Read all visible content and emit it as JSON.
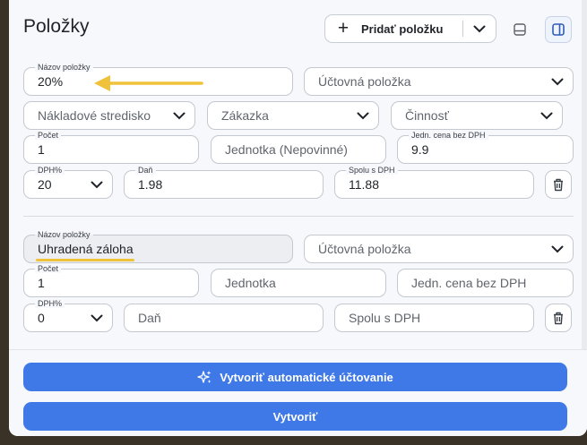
{
  "header": {
    "title": "Položky",
    "add_label": "Pridať položku"
  },
  "item1": {
    "name": {
      "label": "Názov položky",
      "value": "20%"
    },
    "account": {
      "placeholder": "Účtovná položka"
    },
    "cost_center": {
      "placeholder": "Nákladové stredisko"
    },
    "order": {
      "placeholder": "Zákazka"
    },
    "activity": {
      "placeholder": "Činnosť"
    },
    "qty": {
      "label": "Počet",
      "value": "1"
    },
    "unit": {
      "placeholder": "Jednotka (Nepovinné)"
    },
    "unit_price": {
      "label": "Jedn. cena bez DPH",
      "value": "9.9"
    },
    "vat": {
      "label": "DPH%",
      "value": "20"
    },
    "tax": {
      "label": "Daň",
      "value": "1.98"
    },
    "total": {
      "label": "Spolu s DPH",
      "value": "11.88"
    }
  },
  "item2": {
    "name": {
      "label": "Názov položky",
      "value": "Uhradená záloha"
    },
    "account": {
      "placeholder": "Účtovná položka"
    },
    "qty": {
      "label": "Počet",
      "value": "1"
    },
    "unit": {
      "placeholder": "Jednotka"
    },
    "unit_price": {
      "placeholder": "Jedn. cena bez DPH"
    },
    "vat": {
      "label": "DPH%",
      "value": "0"
    },
    "tax": {
      "placeholder": "Daň"
    },
    "total": {
      "placeholder": "Spolu s DPH"
    }
  },
  "footer": {
    "auto_label": "Vytvoriť automatické účtovanie",
    "create_label": "Vytvoriť"
  },
  "colors": {
    "primary": "#3f79e8",
    "annotation": "#f0c23a"
  },
  "icons": [
    "plus-icon",
    "chevron-down-icon",
    "layout-bottom-icon",
    "layout-side-icon",
    "trash-icon",
    "sparkles-icon",
    "arrow-left-icon"
  ]
}
